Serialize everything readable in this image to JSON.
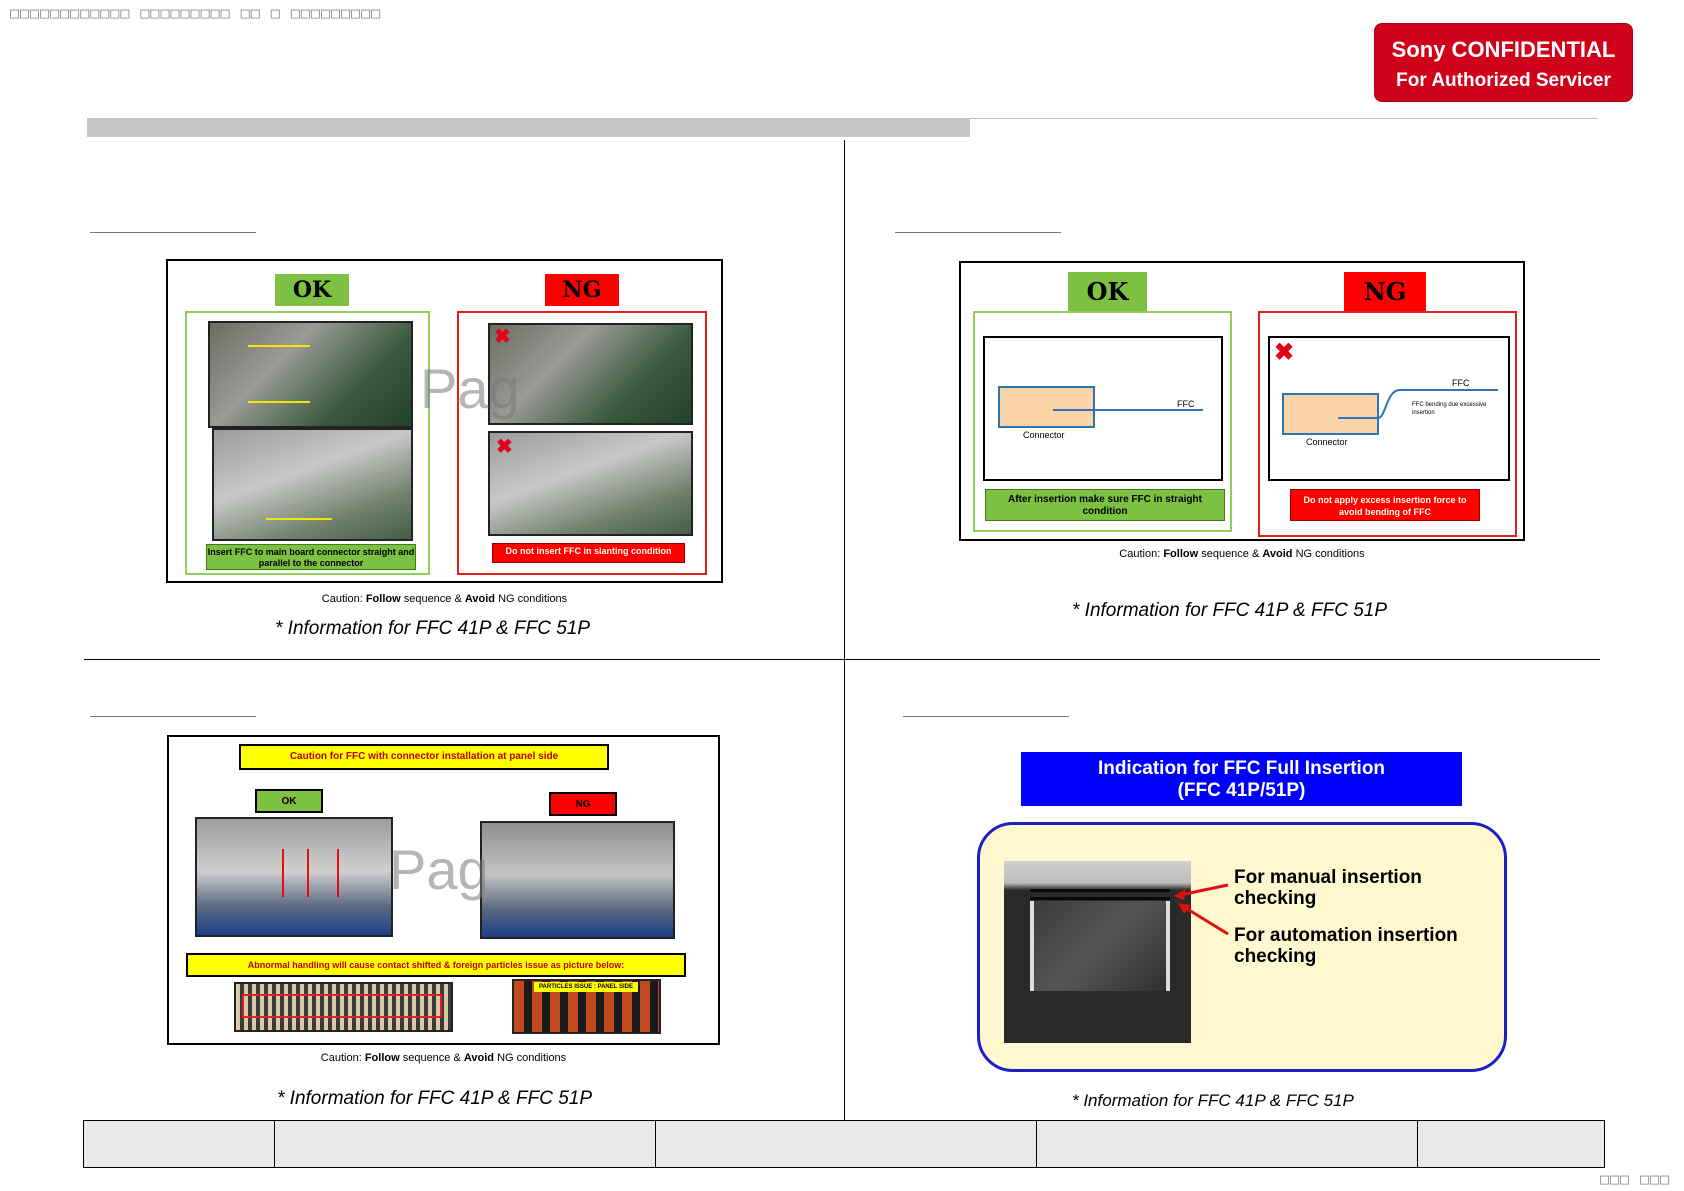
{
  "page": {
    "header_garbled": "□□□□□□□□□□□□ □□□□□□□□□ □□ □ □□□□□□□□□",
    "footer_garbled": "□□□ □□□"
  },
  "confidential": {
    "line1": "Sony CONFIDENTIAL",
    "line2": "For Authorized Servicer"
  },
  "quadrants": {
    "top_left": {
      "ok_label": "OK",
      "ng_label": "NG",
      "ok_note": "Insert FFC to main board connector straight and parallel to the connector",
      "ng_note": "Do not insert FFC in slanting condition",
      "watermark": "Pag",
      "caption_pre": "Caution: ",
      "caption_b1": "Follow",
      "caption_mid": " sequence & ",
      "caption_b2": "Avoid",
      "caption_post": " NG conditions",
      "info": "* Information for FFC 41P & FFC 51P"
    },
    "top_right": {
      "ok_label": "OK",
      "ng_label": "NG",
      "ok_ffc": "FFC",
      "ok_connector": "Connector",
      "ng_ffc": "FFC",
      "ng_bending": "FFC bending due excessive insertion",
      "ng_connector": "Connector",
      "ok_note": "After insertion make sure FFC in straight condition",
      "ng_note": "Do not apply excess insertion force to avoid bending of FFC",
      "caption_pre": "Caution: ",
      "caption_b1": "Follow",
      "caption_mid": " sequence & ",
      "caption_b2": "Avoid",
      "caption_post": " NG conditions",
      "info": "* Information for FFC 41P & FFC 51P"
    },
    "bottom_left": {
      "top_banner": "Caution for FFC with connector installation at panel side",
      "ok_label": "OK",
      "ng_label": "NG",
      "watermark": "Pag",
      "bottom_banner": "Abnormal handling will cause contact shifted & foreign particles issue as picture below:",
      "particles_tag": "PARTICLES ISSUE : PANEL SIDE",
      "caption_pre": "Caution: ",
      "caption_b1": "Follow",
      "caption_mid": " sequence & ",
      "caption_b2": "Avoid",
      "caption_post": " NG conditions",
      "info": "* Information for FFC 41P & FFC 51P"
    },
    "bottom_right": {
      "title_line1": "Indication for FFC Full Insertion",
      "title_line2": "(FFC 41P/51P)",
      "manual_label": "For manual insertion checking",
      "auto_label": "For automation insertion checking",
      "info": "* Information for FFC 41P & FFC 51P"
    }
  },
  "colors": {
    "confidential_red": "#d0021b",
    "ok_green": "#7dc142",
    "ng_red": "#ff0000",
    "banner_blue": "#0000ff",
    "banner_yellow": "#ffff00"
  }
}
